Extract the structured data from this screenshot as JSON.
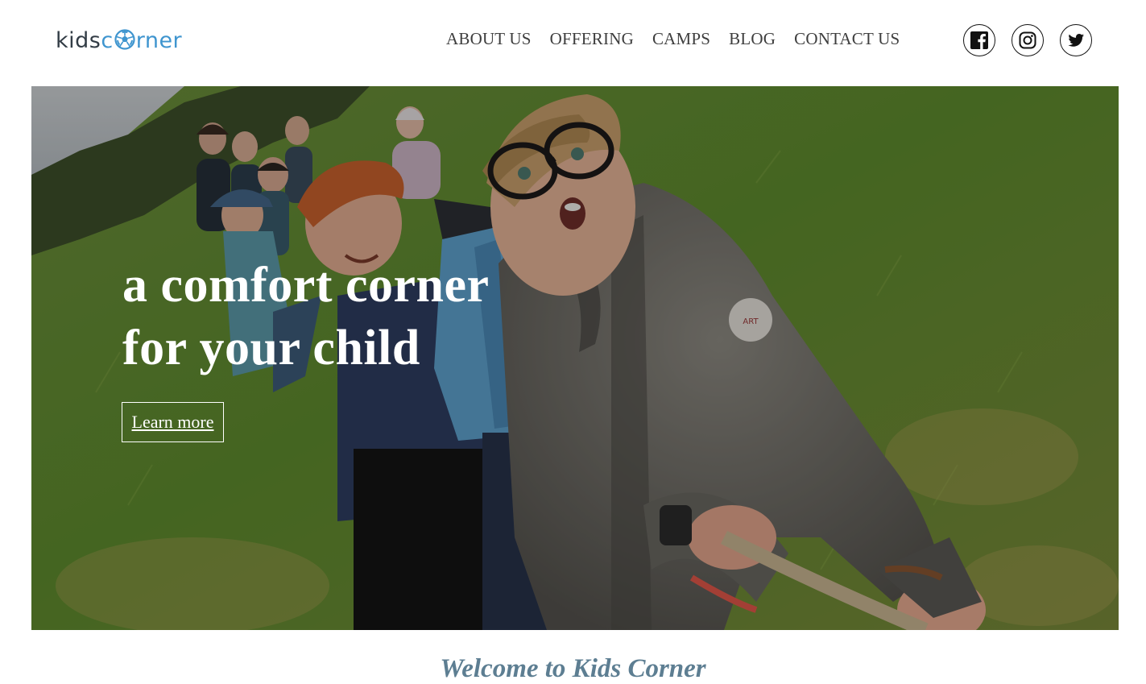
{
  "logo": {
    "part1": "kids",
    "part2": "c",
    "part3": "rner",
    "icon": "soccer-ball-icon"
  },
  "nav": {
    "items": [
      {
        "label": "ABOUT US"
      },
      {
        "label": "OFFERING"
      },
      {
        "label": "CAMPS"
      },
      {
        "label": "BLOG"
      },
      {
        "label": "CONTACT US"
      }
    ]
  },
  "social": [
    {
      "icon": "facebook-icon"
    },
    {
      "icon": "instagram-icon"
    },
    {
      "icon": "twitter-icon"
    }
  ],
  "hero": {
    "title_line1": "a comfort corner",
    "title_line2": "for your child",
    "button_label": "Learn more"
  },
  "welcome": {
    "heading": "Welcome to Kids Corner"
  },
  "colors": {
    "brand_blue": "#3f95cf",
    "logo_dark": "#333d46",
    "welcome_text": "#5d7e92"
  }
}
